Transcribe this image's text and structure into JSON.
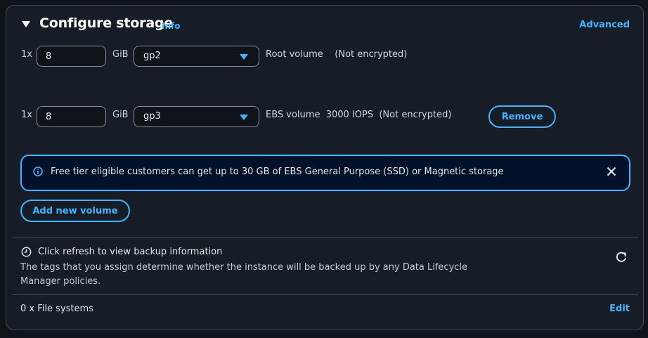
{
  "header": {
    "title": "Configure storage",
    "info_label": "Info",
    "advanced_label": "Advanced"
  },
  "volumes": [
    {
      "multiplier": "1x",
      "size": "8",
      "unit": "GiB",
      "type": "gp2",
      "description": "Root volume    (Not encrypted)"
    },
    {
      "multiplier": "1x",
      "size": "8",
      "unit": "GiB",
      "type": "gp3",
      "description": "EBS volume  3000 IOPS  (Not encrypted)",
      "remove_label": "Remove"
    }
  ],
  "alert": {
    "text": "Free tier eligible customers can get up to 30 GB of EBS General Purpose (SSD) or Magnetic storage",
    "icon": "info-icon",
    "close_icon": "close-icon"
  },
  "add_volume_label": "Add new volume",
  "backup": {
    "title": "Click refresh to view backup information",
    "description": "The tags that you assign determine whether the instance will be backed up by any Data Lifecycle Manager policies.",
    "icon": "clock-icon",
    "refresh_icon": "refresh-icon"
  },
  "file_systems": {
    "label": "0 x File systems",
    "edit_label": "Edit"
  },
  "colors": {
    "accent": "#42b4ff",
    "panel_bg": "#161d26",
    "alert_bg": "#001129",
    "border": "#414d5c"
  }
}
